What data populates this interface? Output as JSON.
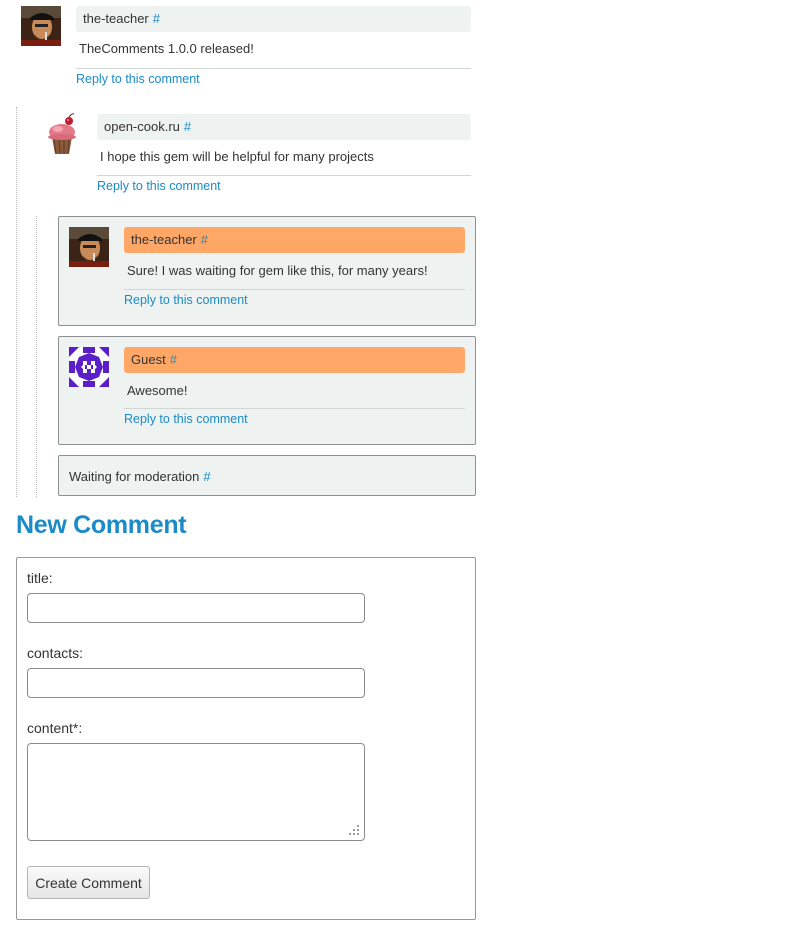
{
  "comments": [
    {
      "author": "the-teacher",
      "anchor": "#",
      "text": "TheComments 1.0.0 released!",
      "reply": "Reply to this comment",
      "avatar": "teacher-avatar"
    },
    {
      "author": "open-cook.ru",
      "anchor": "#",
      "text": "I hope this gem will be helpful for many projects",
      "reply": "Reply to this comment",
      "avatar": "cupcake-avatar"
    },
    {
      "author": "the-teacher",
      "anchor": "#",
      "text": "Sure! I was waiting for gem like this, for many years!",
      "reply": "Reply to this comment",
      "avatar": "teacher-avatar"
    },
    {
      "author": "Guest",
      "anchor": "#",
      "text": "Awesome!",
      "reply": "Reply to this comment",
      "avatar": "identicon-avatar"
    }
  ],
  "moderation": {
    "text": "Waiting for moderation",
    "anchor": "#"
  },
  "form": {
    "heading": "New Comment",
    "title_label": "title:",
    "title_value": "",
    "contacts_label": "contacts:",
    "contacts_value": "",
    "content_label": "content*:",
    "content_value": "",
    "submit_label": "Create Comment"
  },
  "colors": {
    "accent": "#1a8bc8",
    "highlight": "#ffa766",
    "author_bar": "#eef2f1",
    "box_bg": "#eef3f1"
  }
}
